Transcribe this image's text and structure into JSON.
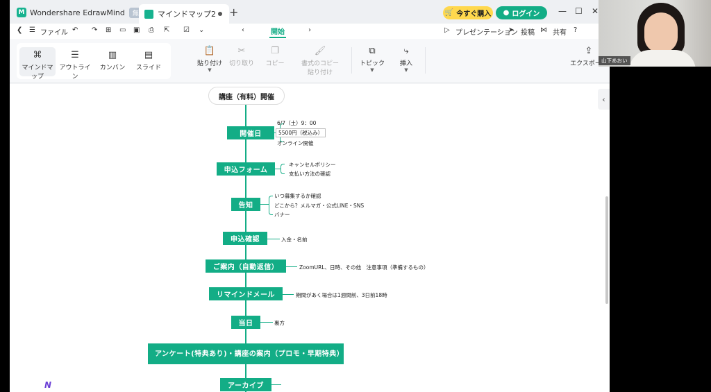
{
  "titlebar": {
    "app_name": "Wondershare EdrawMind",
    "free_badge": "無料",
    "doc_tab": "マインドマップ2",
    "buy_label": "今すぐ購入",
    "login_label": "ログイン"
  },
  "menubar": {
    "file": "ファイル",
    "active_tab": "開始",
    "presentation": "プレゼンテーション",
    "post": "投稿",
    "share": "共有"
  },
  "ribbon": {
    "views": [
      "マインドマップ",
      "アウトライン",
      "カンバン",
      "スライド"
    ],
    "paste": "貼り付け",
    "cut": "切り取り",
    "copy": "コピー",
    "format_paste_1": "書式のコピー",
    "format_paste_2": "貼り付け",
    "topic": "トピック",
    "insert": "挿入",
    "export": "エクスポート"
  },
  "mindmap": {
    "root": "講座（有料）開催",
    "topics": [
      {
        "label": "開催日",
        "subs": [
          "6/7（土）9：00",
          "5500円（税込み）",
          "オンライン開催"
        ]
      },
      {
        "label": "申込フォーム",
        "subs": [
          "キャンセルポリシー",
          "支払い方法の確認"
        ]
      },
      {
        "label": "告知",
        "subs": [
          "いつ募集するか確認",
          "どこから？メルマガ・公式LINE・SNS",
          "バナー"
        ]
      },
      {
        "label": "申込確認",
        "subs": [
          "入金・名前"
        ]
      },
      {
        "label": "ご案内（自動返信）",
        "subs": [
          "ZoomURL、日時、その他　注意事項（準備するもの）"
        ]
      },
      {
        "label": "リマインドメール",
        "subs": [
          "期間があく場合は1週間前、3日前18時"
        ]
      },
      {
        "label": "当日",
        "subs": [
          "裏方"
        ]
      },
      {
        "label": "アンケート(特典あり)・講座の案内（プロモ・早期特典）",
        "subs": []
      },
      {
        "label": "アーカイブ",
        "subs": []
      }
    ]
  },
  "webcam": {
    "participant_name": "山下あおい"
  }
}
